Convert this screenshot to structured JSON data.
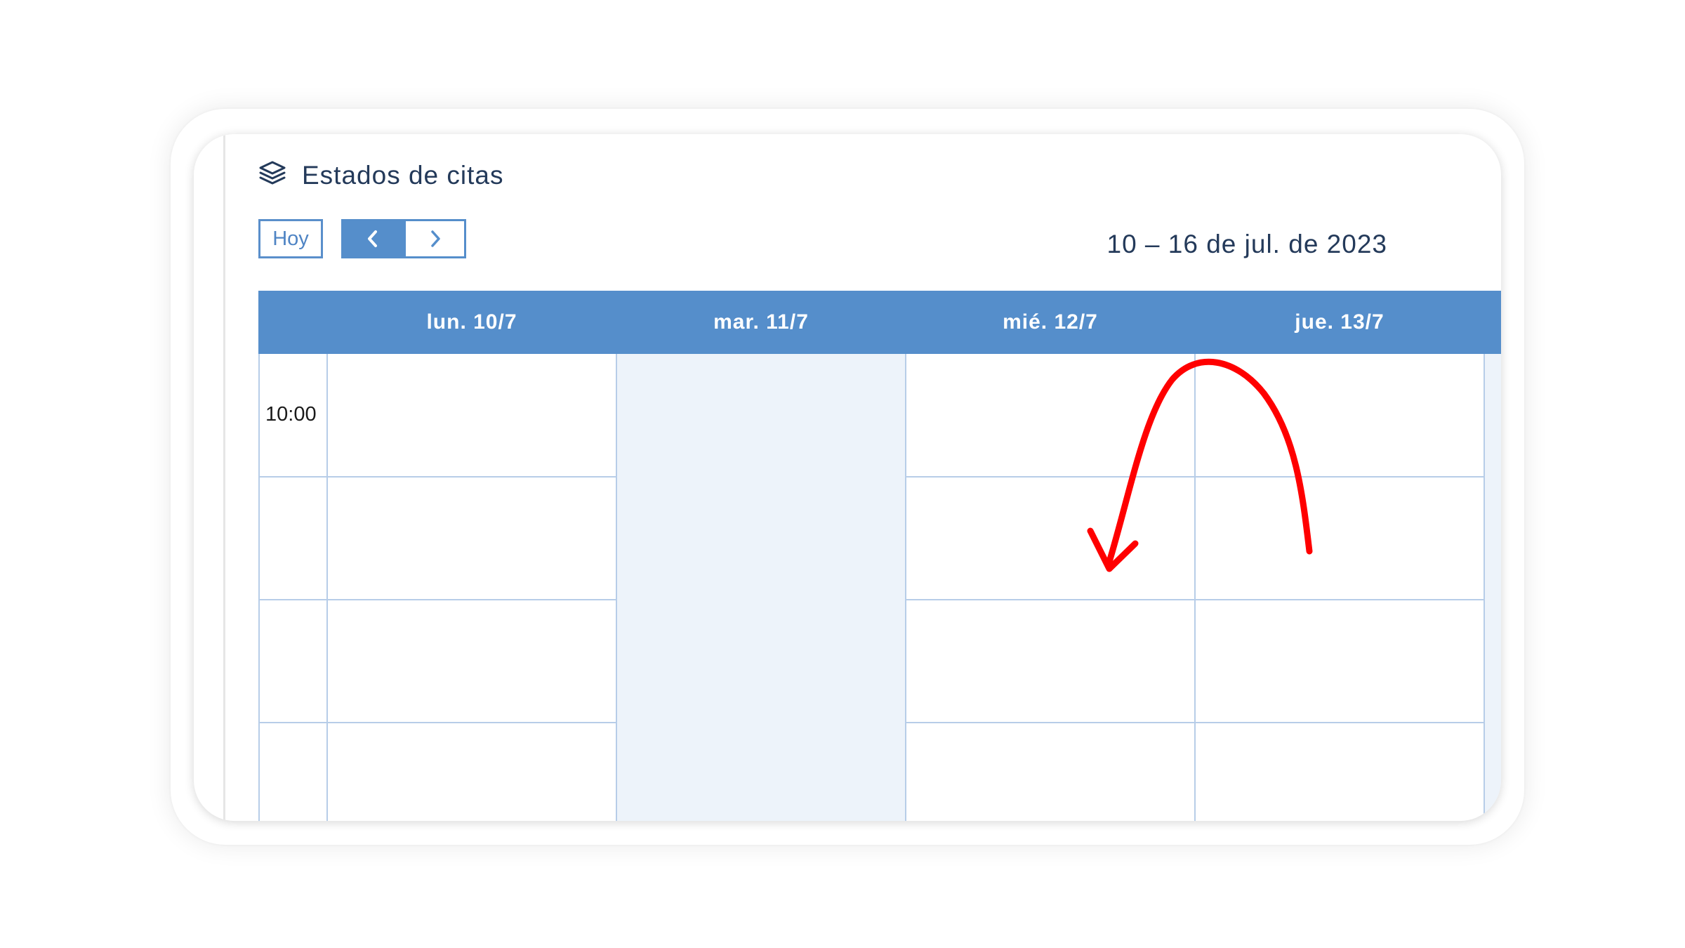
{
  "header": {
    "title": "Estados de citas",
    "title_icon": "layers-icon"
  },
  "toolbar": {
    "today_label": "Hoy",
    "prev_icon": "chevron-left-icon",
    "next_icon": "chevron-right-icon",
    "date_range": "10 – 16 de jul. de 2023"
  },
  "calendar": {
    "days": [
      "lun. 10/7",
      "mar. 11/7",
      "mié. 12/7",
      "jue. 13/7"
    ],
    "time_slots": [
      "10:00"
    ],
    "highlighted_day": "mar. 11/7"
  },
  "colors": {
    "accent": "#558ecb",
    "highlight_column": "#edf3fa",
    "grid_line": "#b7cde8",
    "annotation_arrow": "#ff0000",
    "text_dark": "#243a5a"
  },
  "annotation": {
    "type": "red-arrow-icon"
  }
}
